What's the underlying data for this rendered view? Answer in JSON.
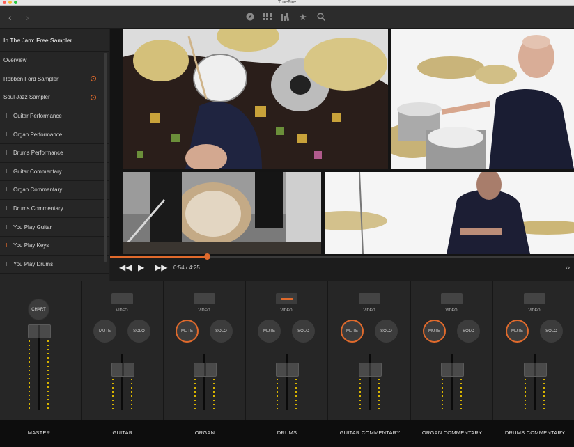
{
  "window": {
    "title": "TrueFire"
  },
  "colors": {
    "accent": "#e06a2c",
    "meter": "#d8b400"
  },
  "toolbar": {
    "back_icon": "back-icon",
    "forward_icon": "forward-icon",
    "center_icons": [
      "compass-icon",
      "grid-icon",
      "library-icon",
      "star-icon",
      "search-icon"
    ]
  },
  "sidebar": {
    "items": [
      {
        "label": "In The Jam: Free Sampler",
        "icon": "",
        "marker": false
      },
      {
        "label": "Overview",
        "icon": "",
        "marker": false
      },
      {
        "label": "Robben Ford Sampler",
        "icon": "",
        "marker": true
      },
      {
        "label": "Soul Jazz Sampler",
        "icon": "",
        "marker": true
      },
      {
        "label": "Guitar Performance",
        "icon": "track-icon",
        "marker": false
      },
      {
        "label": "Organ Performance",
        "icon": "track-icon",
        "marker": false
      },
      {
        "label": "Drums Performance",
        "icon": "track-icon",
        "marker": false
      },
      {
        "label": "Guitar Commentary",
        "icon": "track-icon",
        "marker": false
      },
      {
        "label": "Organ Commentary",
        "icon": "track-icon",
        "marker": false
      },
      {
        "label": "Drums Commentary",
        "icon": "track-icon",
        "marker": false
      },
      {
        "label": "You Play Guitar",
        "icon": "track-icon",
        "marker": false
      },
      {
        "label": "You Play Keys",
        "icon": "track-icon-active",
        "marker": false
      },
      {
        "label": "You Play Drums",
        "icon": "track-icon",
        "marker": false
      }
    ]
  },
  "player": {
    "time": "0:54 / 4:25",
    "progress": 0.2
  },
  "mixer": {
    "chart_label": "CHART",
    "video_label": "VIDEO",
    "mute_label": "MUTE",
    "solo_label": "SOLO",
    "channels": [
      {
        "name": "MASTER",
        "video_on": false,
        "mute_on": false
      },
      {
        "name": "GUITAR",
        "video_on": false,
        "mute_on": false
      },
      {
        "name": "ORGAN",
        "video_on": false,
        "mute_on": true
      },
      {
        "name": "DRUMS",
        "video_on": true,
        "mute_on": false
      },
      {
        "name": "GUITAR COMMENTARY",
        "video_on": false,
        "mute_on": true
      },
      {
        "name": "ORGAN COMMENTARY",
        "video_on": false,
        "mute_on": true
      },
      {
        "name": "DRUMS COMMENTARY",
        "video_on": false,
        "mute_on": true
      }
    ]
  }
}
